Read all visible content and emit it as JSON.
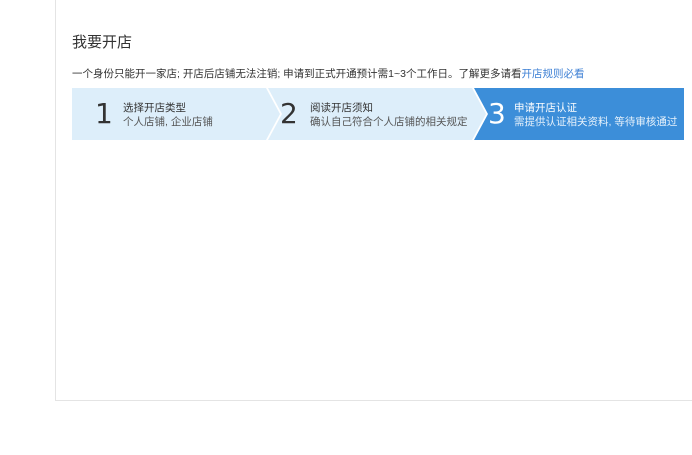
{
  "page": {
    "title": "我要开店",
    "intro": "一个身份只能开一家店; 开店后店铺无法注销; 申请到正式开通预计需1~3个工作日。了解更多请看",
    "intro_link": "开店规则必看"
  },
  "steps": [
    {
      "num": "1",
      "title": "选择开店类型",
      "sub": "个人店铺, 企业店铺"
    },
    {
      "num": "2",
      "title": "阅读开店须知",
      "sub": "确认自己符合个人店铺的相关规定"
    },
    {
      "num": "3",
      "title": "申请开店认证",
      "sub": "需提供认证相关资料, 等待审核通过"
    }
  ],
  "colors": {
    "step_done": "#ddeefa",
    "step_current": "#3c8ed9",
    "link": "#3c7fd4"
  }
}
